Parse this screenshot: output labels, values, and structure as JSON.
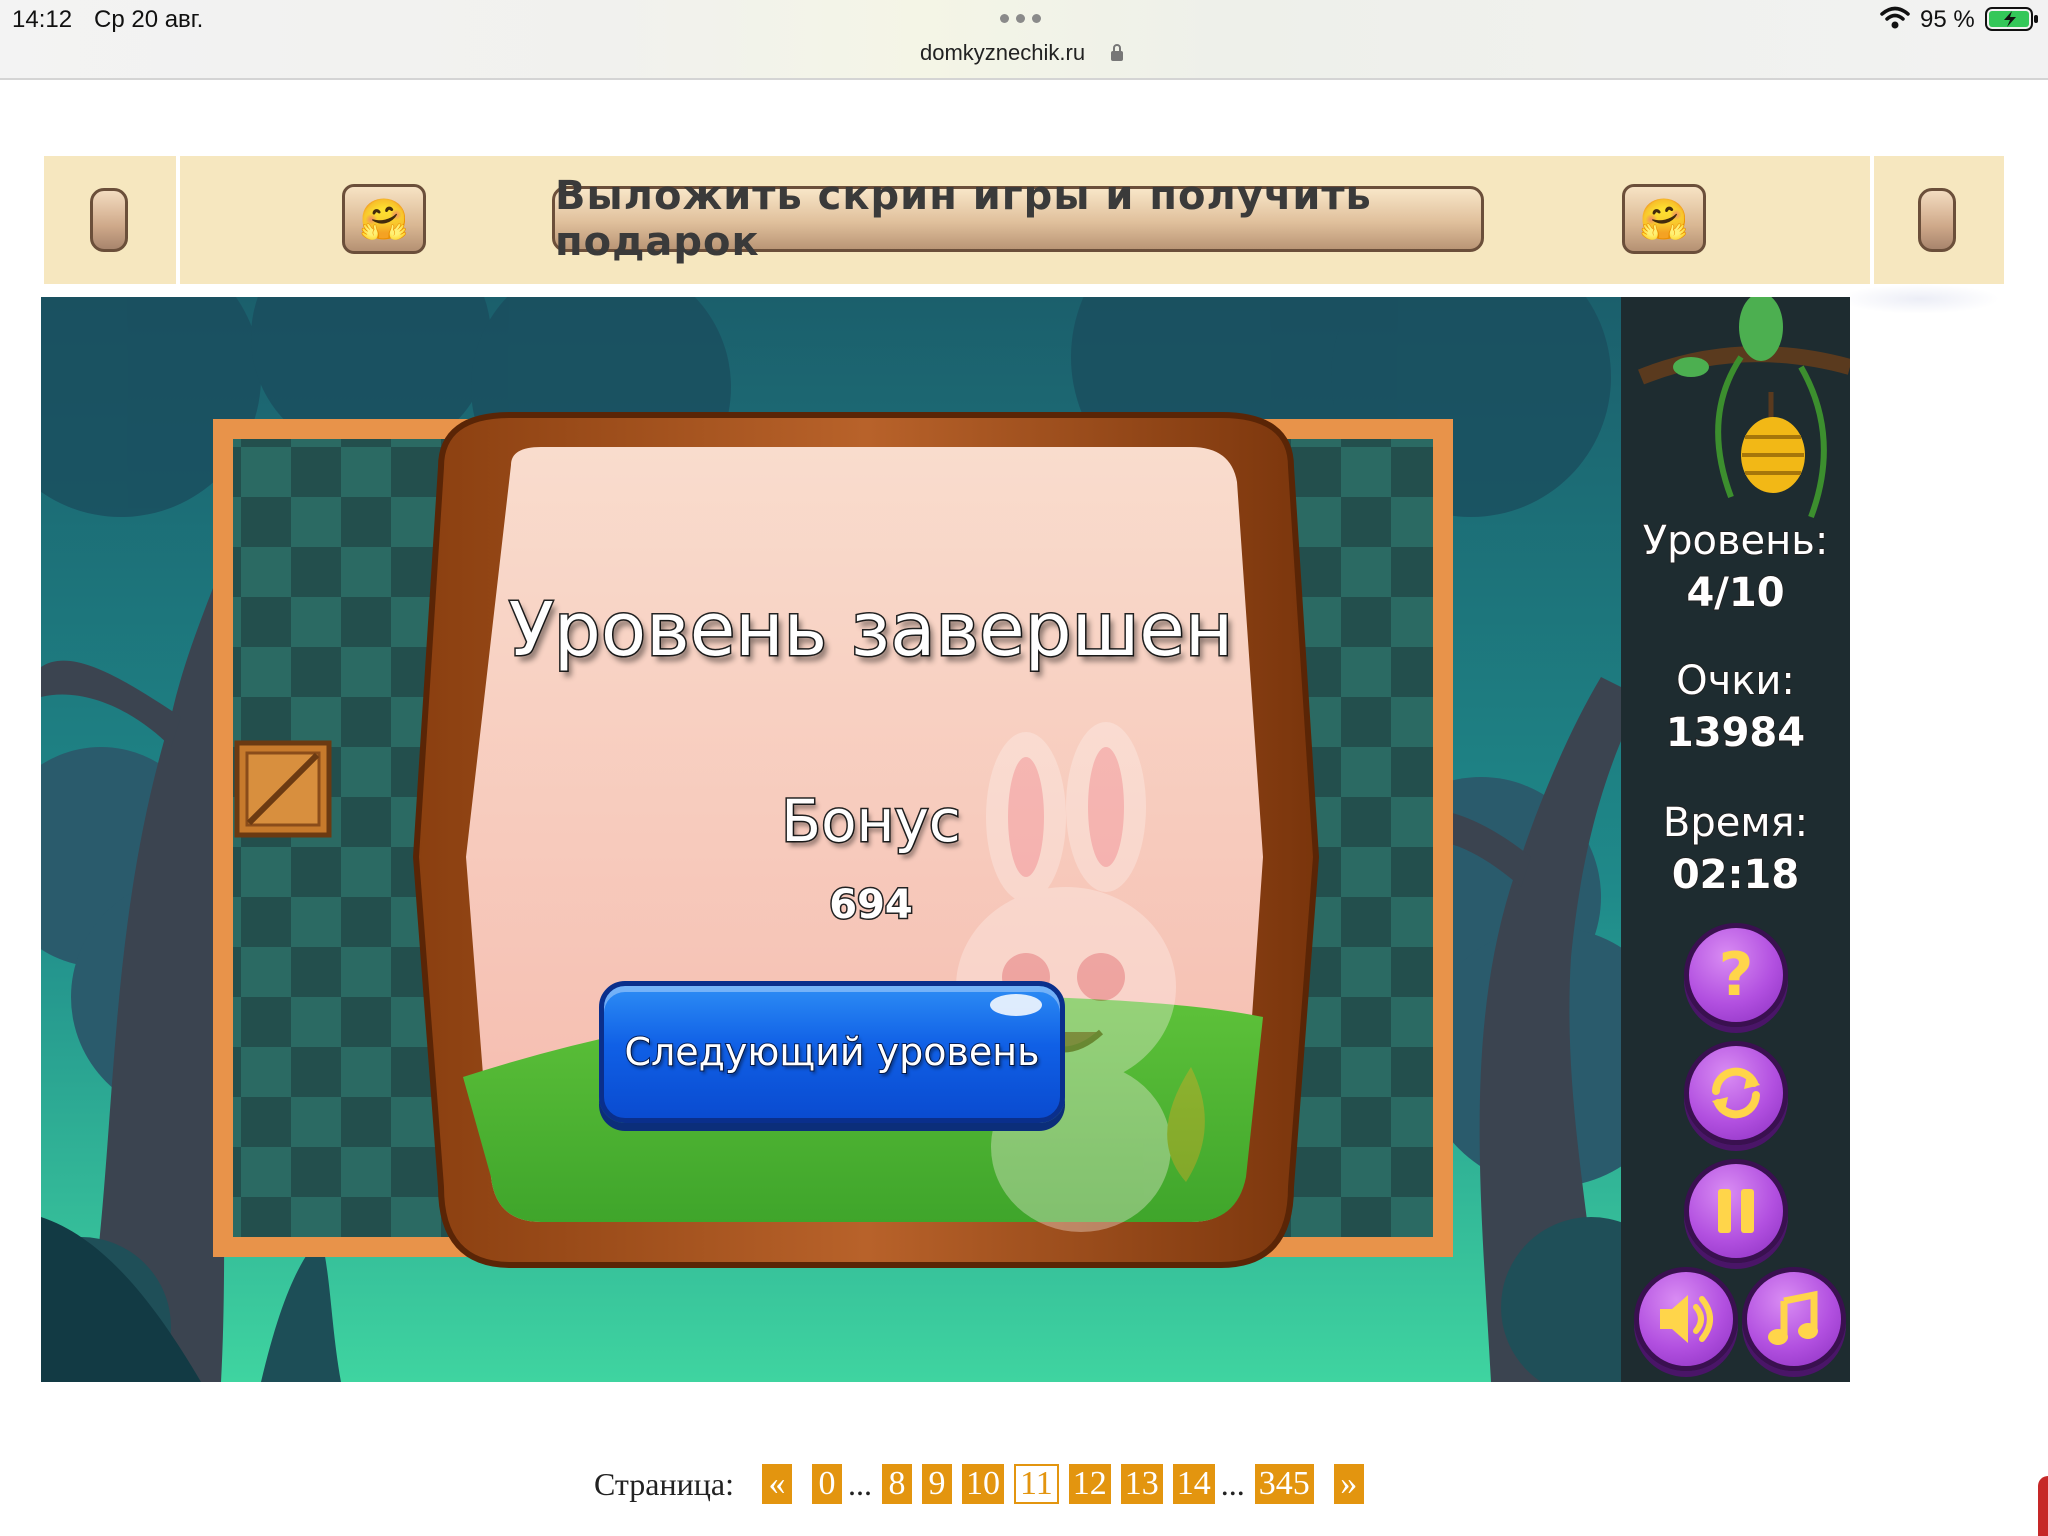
{
  "status_bar": {
    "time": "14:12",
    "date": "Ср 20 авг.",
    "url": "domkyznechik.ru",
    "battery": "95 %"
  },
  "banner": {
    "promo_label": "Выложить скрин игры и получить подарок",
    "emoji": "🤗"
  },
  "game": {
    "dialog": {
      "title": "Уровень завершен",
      "bonus_label": "Бонус",
      "bonus_value": "694",
      "next_button": "Следующий уровень"
    },
    "hud": {
      "level_label": "Уровень:",
      "level_value": "4/10",
      "score_label": "Очки:",
      "score_value": "13984",
      "time_label": "Время:",
      "time_value": "02:18"
    },
    "controls": {
      "help": "?",
      "restart_icon": "restart-icon",
      "pause_icon": "pause-icon",
      "sound_icon": "speaker-icon",
      "music_icon": "music-note-icon"
    },
    "colors": {
      "button_purple": "#b250e0",
      "icon_yellow": "#ffd54a",
      "next_button_blue": "#1060e6"
    }
  },
  "pagination": {
    "label": "Страница:",
    "prev": "«",
    "next": "»",
    "ellipsis": "...",
    "pages": [
      "0",
      "8",
      "9",
      "10",
      "11",
      "12",
      "13",
      "14",
      "345"
    ],
    "current": "11"
  }
}
